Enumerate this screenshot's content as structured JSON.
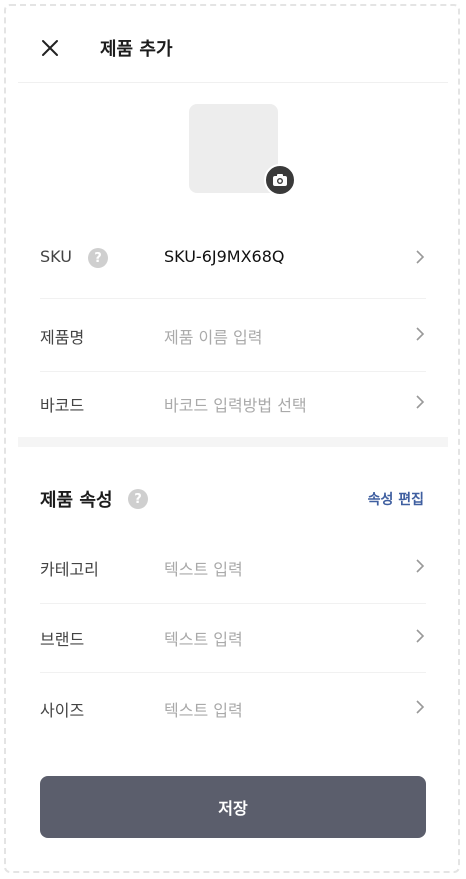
{
  "header": {
    "title": "제품 추가"
  },
  "product": {
    "sku": {
      "label": "SKU",
      "help": "?",
      "value": "SKU-6J9MX68Q"
    },
    "name": {
      "label": "제품명",
      "placeholder": "제품 이름 입력"
    },
    "barcode": {
      "label": "바코드",
      "placeholder": "바코드 입력방법 선택"
    }
  },
  "attributes": {
    "title": "제품 속성",
    "help": "?",
    "edit_label": "속성 편집",
    "items": [
      {
        "label": "카테고리",
        "placeholder": "텍스트 입력"
      },
      {
        "label": "브랜드",
        "placeholder": "텍스트 입력"
      },
      {
        "label": "사이즈",
        "placeholder": "텍스트 입력"
      }
    ]
  },
  "footer": {
    "save_label": "저장"
  },
  "colors": {
    "accent": "#3f5fa0",
    "save_button": "#5b5e6c"
  }
}
